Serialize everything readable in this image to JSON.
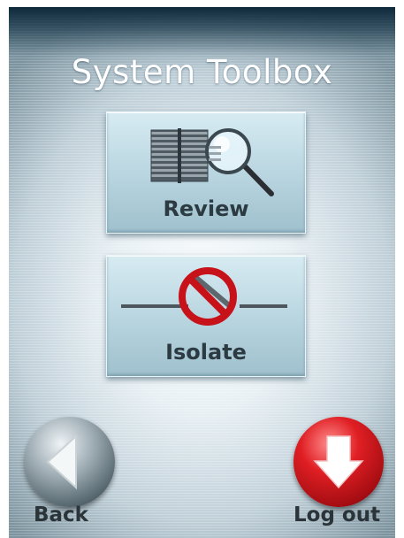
{
  "app": {
    "title": "System Toolbox"
  },
  "tiles": [
    {
      "label": "Review",
      "icon": "document-magnifier-icon"
    },
    {
      "label": "Isolate",
      "icon": "prohibited-switch-icon"
    }
  ],
  "nav": {
    "back_label": "Back",
    "back_icon": "left-arrow-icon",
    "logout_label": "Log out",
    "logout_icon": "down-arrow-icon"
  },
  "colors": {
    "title_bar": "#0e2a3a",
    "tile": "#b7d4df",
    "back_button": "#56676f",
    "logout_button": "#e01f24"
  }
}
